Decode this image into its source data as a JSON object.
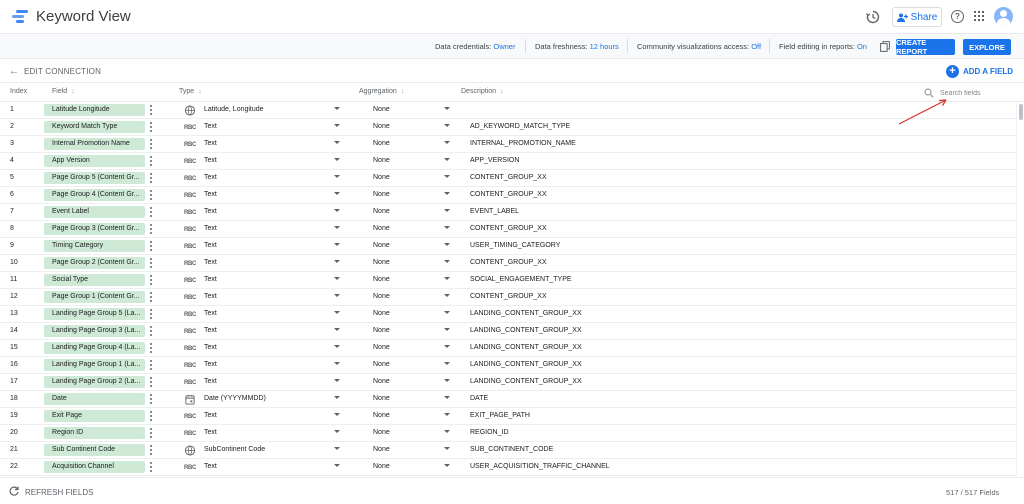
{
  "app": {
    "title": "Keyword View"
  },
  "topbar": {
    "share_label": "Share",
    "help_glyph": "?"
  },
  "infobar": {
    "items": [
      {
        "label": "Data credentials:",
        "value": "Owner"
      },
      {
        "label": "Data freshness:",
        "value": "12 hours"
      },
      {
        "label": "Community visualizations access:",
        "value": "Off"
      },
      {
        "label": "Field editing in reports:",
        "value": "On"
      }
    ],
    "create_report_label": "CREATE REPORT",
    "explore_label": "EXPLORE"
  },
  "toolbar": {
    "edit_connection_label": "EDIT CONNECTION",
    "add_field_label": "ADD A FIELD",
    "add_glyph": "+"
  },
  "table": {
    "columns": {
      "index": "Index",
      "field": "Field",
      "type": "Type",
      "aggregation": "Aggregation",
      "description": "Description"
    },
    "search_placeholder": "Search fields",
    "rows": [
      {
        "index": "1",
        "field": "Latitude Longitude",
        "type_icon": "globe-icon",
        "type": "Latitude, Longitude",
        "aggregation": "None",
        "description": ""
      },
      {
        "index": "2",
        "field": "Keyword Match Type",
        "type_icon": "text-icon",
        "type": "Text",
        "aggregation": "None",
        "description": "AD_KEYWORD_MATCH_TYPE"
      },
      {
        "index": "3",
        "field": "Internal Promotion Name",
        "type_icon": "text-icon",
        "type": "Text",
        "aggregation": "None",
        "description": "INTERNAL_PROMOTION_NAME"
      },
      {
        "index": "4",
        "field": "App Version",
        "type_icon": "text-icon",
        "type": "Text",
        "aggregation": "None",
        "description": "APP_VERSION"
      },
      {
        "index": "5",
        "field": "Page Group 5 (Content Gr...",
        "type_icon": "text-icon",
        "type": "Text",
        "aggregation": "None",
        "description": "CONTENT_GROUP_XX"
      },
      {
        "index": "6",
        "field": "Page Group 4 (Content Gr...",
        "type_icon": "text-icon",
        "type": "Text",
        "aggregation": "None",
        "description": "CONTENT_GROUP_XX"
      },
      {
        "index": "7",
        "field": "Event Label",
        "type_icon": "text-icon",
        "type": "Text",
        "aggregation": "None",
        "description": "EVENT_LABEL"
      },
      {
        "index": "8",
        "field": "Page Group 3 (Content Gr...",
        "type_icon": "text-icon",
        "type": "Text",
        "aggregation": "None",
        "description": "CONTENT_GROUP_XX"
      },
      {
        "index": "9",
        "field": "Timing Category",
        "type_icon": "text-icon",
        "type": "Text",
        "aggregation": "None",
        "description": "USER_TIMING_CATEGORY"
      },
      {
        "index": "10",
        "field": "Page Group 2 (Content Gr...",
        "type_icon": "text-icon",
        "type": "Text",
        "aggregation": "None",
        "description": "CONTENT_GROUP_XX"
      },
      {
        "index": "11",
        "field": "Social Type",
        "type_icon": "text-icon",
        "type": "Text",
        "aggregation": "None",
        "description": "SOCIAL_ENGAGEMENT_TYPE"
      },
      {
        "index": "12",
        "field": "Page Group 1 (Content Gr...",
        "type_icon": "text-icon",
        "type": "Text",
        "aggregation": "None",
        "description": "CONTENT_GROUP_XX"
      },
      {
        "index": "13",
        "field": "Landing Page Group 5 (La...",
        "type_icon": "text-icon",
        "type": "Text",
        "aggregation": "None",
        "description": "LANDING_CONTENT_GROUP_XX"
      },
      {
        "index": "14",
        "field": "Landing Page Group 3 (La...",
        "type_icon": "text-icon",
        "type": "Text",
        "aggregation": "None",
        "description": "LANDING_CONTENT_GROUP_XX"
      },
      {
        "index": "15",
        "field": "Landing Page Group 4 (La...",
        "type_icon": "text-icon",
        "type": "Text",
        "aggregation": "None",
        "description": "LANDING_CONTENT_GROUP_XX"
      },
      {
        "index": "16",
        "field": "Landing Page Group 1 (La...",
        "type_icon": "text-icon",
        "type": "Text",
        "aggregation": "None",
        "description": "LANDING_CONTENT_GROUP_XX"
      },
      {
        "index": "17",
        "field": "Landing Page Group 2 (La...",
        "type_icon": "text-icon",
        "type": "Text",
        "aggregation": "None",
        "description": "LANDING_CONTENT_GROUP_XX"
      },
      {
        "index": "18",
        "field": "Date",
        "type_icon": "calendar-icon",
        "type": "Date (YYYYMMDD)",
        "aggregation": "None",
        "description": "DATE"
      },
      {
        "index": "19",
        "field": "Exit Page",
        "type_icon": "text-icon",
        "type": "Text",
        "aggregation": "None",
        "description": "EXIT_PAGE_PATH"
      },
      {
        "index": "20",
        "field": "Region ID",
        "type_icon": "text-icon",
        "type": "Text",
        "aggregation": "None",
        "description": "REGION_ID"
      },
      {
        "index": "21",
        "field": "Sub Continent Code",
        "type_icon": "globe-icon",
        "type": "SubContinent Code",
        "aggregation": "None",
        "description": "SUB_CONTINENT_CODE"
      },
      {
        "index": "22",
        "field": "Acquisition Channel",
        "type_icon": "text-icon",
        "type": "Text",
        "aggregation": "None",
        "description": "USER_ACQUISITION_TRAFFIC_CHANNEL"
      }
    ]
  },
  "footer": {
    "refresh_label": "REFRESH FIELDS",
    "field_count": "517 / 517 Fields"
  },
  "colors": {
    "accent": "#1a73e8",
    "chip": "#ceead6",
    "annotation_arrow": "#d93025"
  }
}
